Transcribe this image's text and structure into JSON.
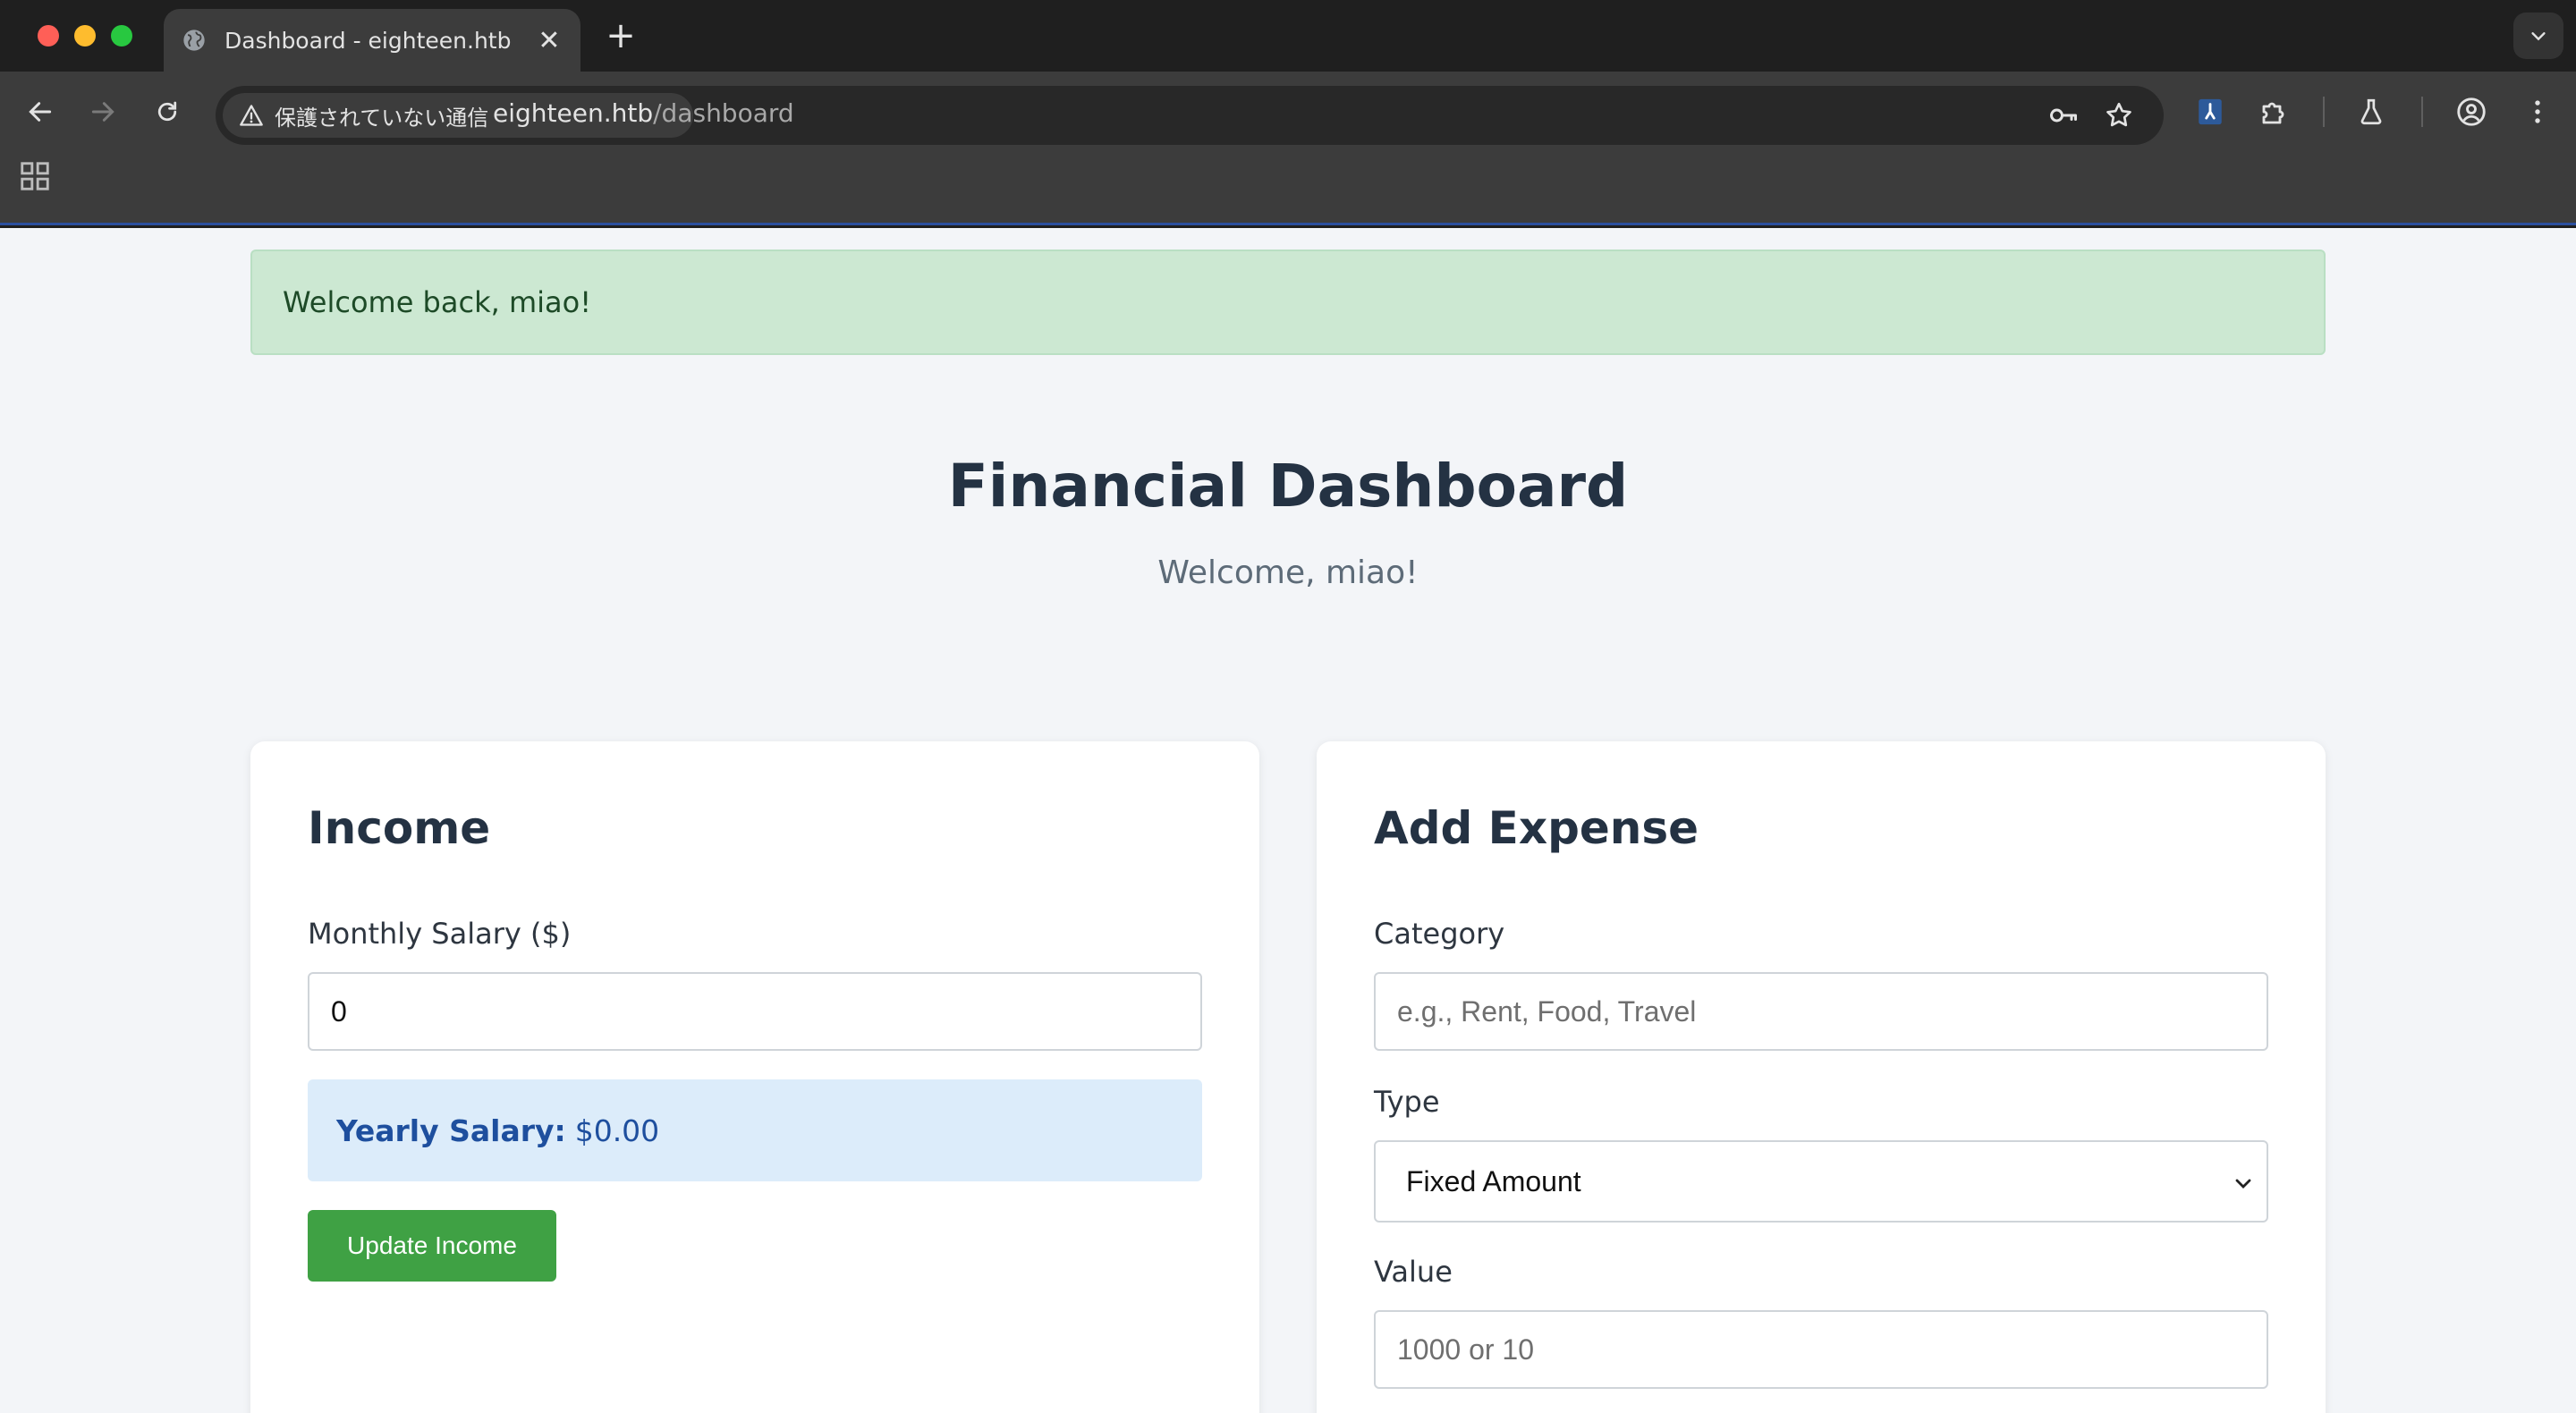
{
  "tab": {
    "title": "Dashboard - eighteen.htb",
    "close": "✕",
    "new_tab": "+"
  },
  "omnibox": {
    "security_label": "保護されていない通信",
    "url_host": "eighteen.htb",
    "url_path": "/dashboard"
  },
  "alert": {
    "message": "Welcome back, miao!"
  },
  "header": {
    "title": "Financial Dashboard",
    "subtitle": "Welcome, miao!"
  },
  "income": {
    "heading": "Income",
    "salary_label": "Monthly Salary ($)",
    "salary_value": "0",
    "yearly_label": "Yearly Salary:",
    "yearly_value": "$0.00",
    "update_button": "Update Income"
  },
  "expense": {
    "heading": "Add Expense",
    "category_label": "Category",
    "category_placeholder": "e.g., Rent, Food, Travel",
    "type_label": "Type",
    "type_selected": "Fixed Amount",
    "value_label": "Value",
    "value_placeholder": "1000 or 10"
  },
  "colors": {
    "alert_bg": "#cce8d2",
    "yearly_bg": "#dcecfa",
    "button_green": "#3fa144",
    "heading": "#243243",
    "page_bg": "#f3f5f8"
  },
  "icons": {
    "tab_favicon": "globe-icon",
    "security": "warning-triangle-icon",
    "password": "key-icon",
    "bookmark": "star-icon",
    "extensions": "puzzle-icon",
    "labs": "flask-icon",
    "profile": "account-circle-icon",
    "menu": "kebab-menu-icon",
    "apps": "apps-grid-icon",
    "select": "chevron-down-icon"
  }
}
